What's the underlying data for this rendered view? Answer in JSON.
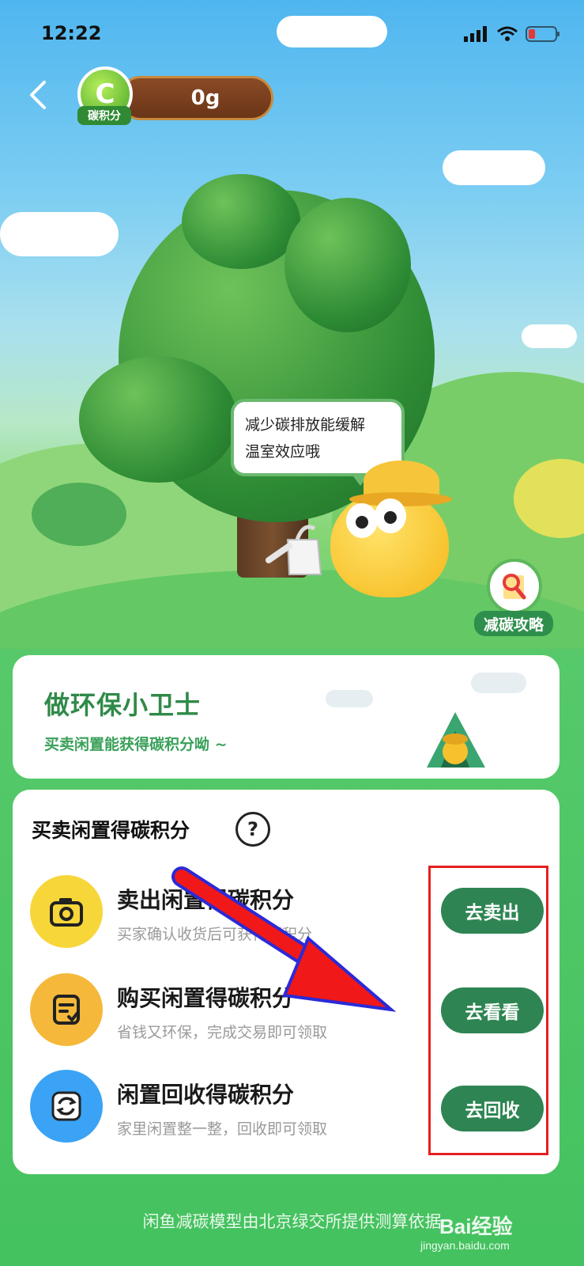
{
  "status_bar": {
    "time": "12:22"
  },
  "header": {
    "carbon_badge_letter": "C",
    "carbon_badge_label": "碳积分",
    "carbon_value": "0g"
  },
  "scene": {
    "bubble_line1": "减少碳排放能缓解",
    "bubble_line2": "温室效应哦",
    "guide_label": "减碳攻略"
  },
  "promo_card": {
    "title": "做环保小卫士",
    "subtitle": "买卖闲置能获得碳积分呦 ~"
  },
  "tasks_card": {
    "title": "买卖闲置得碳积分",
    "help_glyph": "?",
    "tasks": [
      {
        "title": "卖出闲置得碳积分",
        "desc": "买家确认收货后可获得碳积分",
        "button": "去卖出",
        "icon": "camera-icon",
        "icon_color": "#f7d63a"
      },
      {
        "title": "购买闲置得碳积分",
        "desc": "省钱又环保，完成交易即可领取",
        "button": "去看看",
        "icon": "order-icon",
        "icon_color": "#f5b83a"
      },
      {
        "title": "闲置回收得碳积分",
        "desc": "家里闲置整一整，回收即可领取",
        "button": "去回收",
        "icon": "recycle-icon",
        "icon_color": "#3aa3f5"
      }
    ]
  },
  "footer": {
    "note": "闲鱼减碳模型由北京绿交所提供测算依据"
  },
  "watermark": {
    "brand": "Bai",
    "brand_cn": "经验",
    "url": "jingyan.baidu.com"
  },
  "colors": {
    "accent_green": "#2e8553",
    "highlight_red": "#e51f1f"
  }
}
